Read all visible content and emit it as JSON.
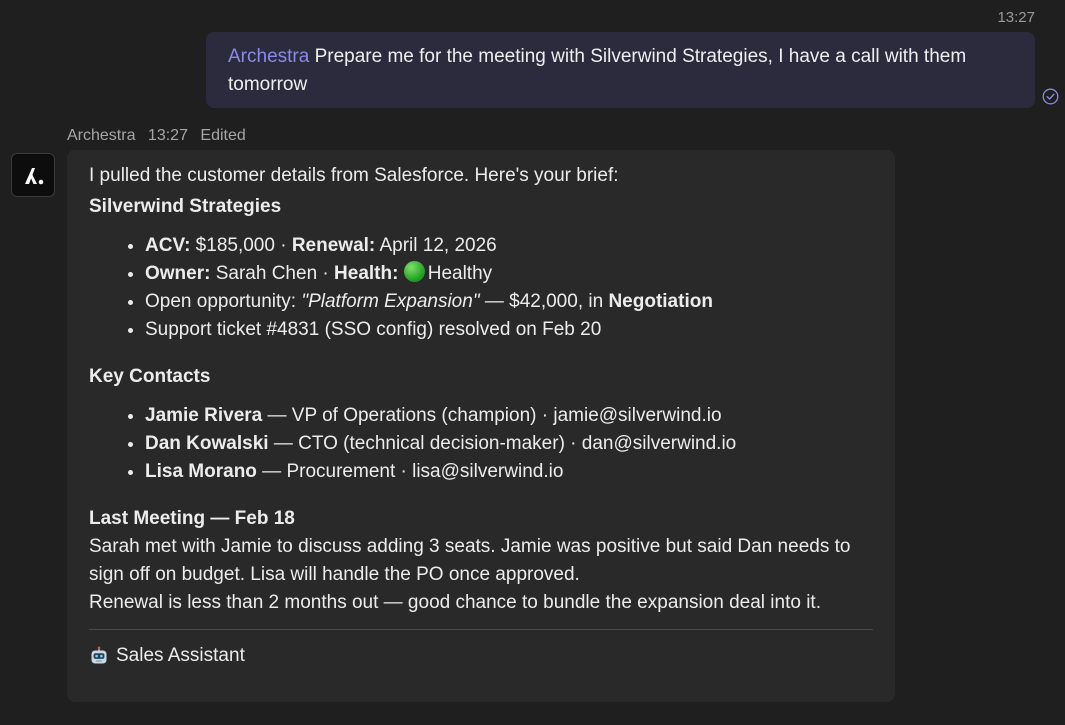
{
  "outgoing": {
    "time": "13:27",
    "mention": "Archestra",
    "text": " Prepare me for the meeting with Silverwind Strategies, I have a call with them tomorrow"
  },
  "incoming": {
    "sender": "Archestra",
    "time": "13:27",
    "edited": "Edited",
    "intro": "I pulled the customer details from Salesforce. Here's your brief:",
    "company": "Silverwind Strategies",
    "summary": {
      "acv_label": "ACV:",
      "acv_value": " $185,000 · ",
      "renewal_label": "Renewal:",
      "renewal_value": " April 12, 2026",
      "owner_label": "Owner:",
      "owner_value": " Sarah Chen · ",
      "health_label": "Health:",
      "health_value": "Healthy",
      "opportunity_prefix": "Open opportunity: ",
      "opportunity_name": "\"Platform Expansion\"",
      "opportunity_mid": " — $42,000, in ",
      "opportunity_stage": "Negotiation",
      "ticket": "Support ticket #4831 (SSO config) resolved on Feb 20"
    },
    "contacts_heading": "Key Contacts",
    "contacts": [
      {
        "name": "Jamie Rivera",
        "detail": " — VP of Operations (champion) · jamie@silverwind.io"
      },
      {
        "name": "Dan Kowalski",
        "detail": " — CTO (technical decision-maker) · dan@silverwind.io"
      },
      {
        "name": "Lisa Morano",
        "detail": " — Procurement · lisa@silverwind.io"
      }
    ],
    "last_meeting_heading": "Last Meeting — Feb 18",
    "last_meeting_text": "Sarah met with Jamie to discuss adding 3 seats. Jamie was positive but said Dan needs to sign off on budget. Lisa will handle the PO once approved.",
    "renewal_note": "Renewal is less than 2 months out — good chance to bundle the expansion deal into it.",
    "signature": "Sales Assistant"
  },
  "colors": {
    "background": "#1f1f1f",
    "outgoing_bubble": "#2c2b3d",
    "incoming_bubble": "#292929",
    "mention": "#8b88e8",
    "health_status": "#2db52d"
  },
  "icons": {
    "read_receipt": "check-circle-icon",
    "avatar": "archestra-logo-icon",
    "health": "green-circle-icon",
    "signature": "robot-icon"
  }
}
